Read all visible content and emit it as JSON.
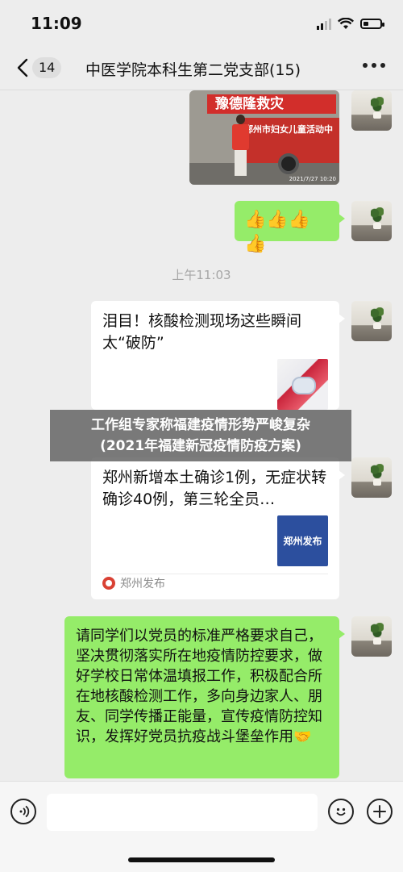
{
  "status": {
    "time": "11:09"
  },
  "nav": {
    "back_icon": "chevron-left-icon",
    "unread_count": "14",
    "title": "中医学院本科生第二党支部(15)",
    "more_icon": "more-dots-icon"
  },
  "messages": {
    "photo": {
      "banner": "豫德隆救灾",
      "truck_text": "郑州市妇女儿童活动中",
      "stamp": "2021/7/27 10:20"
    },
    "thumbs": "👍👍👍👍",
    "timestamp": "上午11:03",
    "card1": {
      "title": "泪目！核酸检测现场这些瞬间太“破防”",
      "source": "郑州发布"
    },
    "card2": {
      "title": "郑州新增本土确诊1例，无症状转确诊40例，第三轮全员…",
      "thumb_label": "郑州发布",
      "source": "郑州发布"
    },
    "long_text": "请同学们以党员的标准严格要求自己，坚决贯彻落实所在地疫情防控要求，做好学校日常体温填报工作，积极配合所在地核酸检测工作，多向身边家人、朋友、同学传播正能量，宣传疫情防控知识，发挥好党员抗疫战斗堡垒作用🤝"
  },
  "overlay": {
    "line1": "工作组专家称福建疫情形势严峻复杂",
    "line2": "(2021年福建新冠疫情防疫方案)"
  },
  "input": {
    "voice_icon": "voice-icon",
    "emoji_icon": "emoji-icon",
    "plus_icon": "plus-icon"
  }
}
